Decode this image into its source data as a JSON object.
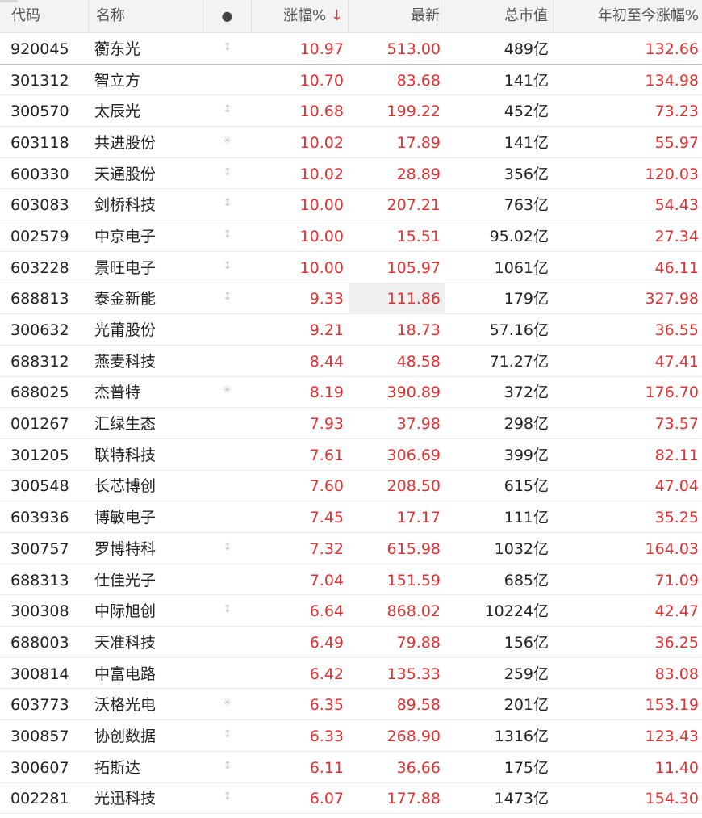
{
  "columns": {
    "code": "代码",
    "name": "名称",
    "mark": "●",
    "change_pct": "涨幅%",
    "sort_arrow": "↓",
    "last": "最新",
    "market_cap": "总市值",
    "ytd_pct": "年初至今涨幅%"
  },
  "rows": [
    {
      "code": "920045",
      "name": "蘅东光",
      "mark": "↕",
      "change_pct": "10.97",
      "last": "513.00",
      "market_cap": "489亿",
      "ytd_pct": "132.66"
    },
    {
      "code": "301312",
      "name": "智立方",
      "mark": "",
      "change_pct": "10.70",
      "last": "83.68",
      "market_cap": "141亿",
      "ytd_pct": "134.98"
    },
    {
      "code": "300570",
      "name": "太辰光",
      "mark": "↕",
      "change_pct": "10.68",
      "last": "199.22",
      "market_cap": "452亿",
      "ytd_pct": "73.23"
    },
    {
      "code": "603118",
      "name": "共进股份",
      "mark": "✳",
      "change_pct": "10.02",
      "last": "17.89",
      "market_cap": "141亿",
      "ytd_pct": "55.97"
    },
    {
      "code": "600330",
      "name": "天通股份",
      "mark": "↕",
      "change_pct": "10.02",
      "last": "28.89",
      "market_cap": "356亿",
      "ytd_pct": "120.03"
    },
    {
      "code": "603083",
      "name": "剑桥科技",
      "mark": "↕",
      "change_pct": "10.00",
      "last": "207.21",
      "market_cap": "763亿",
      "ytd_pct": "54.43"
    },
    {
      "code": "002579",
      "name": "中京电子",
      "mark": "↕",
      "change_pct": "10.00",
      "last": "15.51",
      "market_cap": "95.02亿",
      "ytd_pct": "27.34"
    },
    {
      "code": "603228",
      "name": "景旺电子",
      "mark": "↕",
      "change_pct": "10.00",
      "last": "105.97",
      "market_cap": "1061亿",
      "ytd_pct": "46.11"
    },
    {
      "code": "688813",
      "name": "泰金新能",
      "mark": "↕",
      "change_pct": "9.33",
      "last": "111.86",
      "market_cap": "179亿",
      "ytd_pct": "327.98",
      "highlight_last": true
    },
    {
      "code": "300632",
      "name": "光莆股份",
      "mark": "",
      "change_pct": "9.21",
      "last": "18.73",
      "market_cap": "57.16亿",
      "ytd_pct": "36.55"
    },
    {
      "code": "688312",
      "name": "燕麦科技",
      "mark": "",
      "change_pct": "8.44",
      "last": "48.58",
      "market_cap": "71.27亿",
      "ytd_pct": "47.41"
    },
    {
      "code": "688025",
      "name": "杰普特",
      "mark": "✳",
      "change_pct": "8.19",
      "last": "390.89",
      "market_cap": "372亿",
      "ytd_pct": "176.70"
    },
    {
      "code": "001267",
      "name": "汇绿生态",
      "mark": "",
      "change_pct": "7.93",
      "last": "37.98",
      "market_cap": "298亿",
      "ytd_pct": "73.57"
    },
    {
      "code": "301205",
      "name": "联特科技",
      "mark": "",
      "change_pct": "7.61",
      "last": "306.69",
      "market_cap": "399亿",
      "ytd_pct": "82.11"
    },
    {
      "code": "300548",
      "name": "长芯博创",
      "mark": "",
      "change_pct": "7.60",
      "last": "208.50",
      "market_cap": "615亿",
      "ytd_pct": "47.04"
    },
    {
      "code": "603936",
      "name": "博敏电子",
      "mark": "",
      "change_pct": "7.45",
      "last": "17.17",
      "market_cap": "111亿",
      "ytd_pct": "35.25"
    },
    {
      "code": "300757",
      "name": "罗博特科",
      "mark": "↕",
      "change_pct": "7.32",
      "last": "615.98",
      "market_cap": "1032亿",
      "ytd_pct": "164.03"
    },
    {
      "code": "688313",
      "name": "仕佳光子",
      "mark": "",
      "change_pct": "7.04",
      "last": "151.59",
      "market_cap": "685亿",
      "ytd_pct": "71.09"
    },
    {
      "code": "300308",
      "name": "中际旭创",
      "mark": "↕",
      "change_pct": "6.64",
      "last": "868.02",
      "market_cap": "10224亿",
      "ytd_pct": "42.47"
    },
    {
      "code": "688003",
      "name": "天准科技",
      "mark": "",
      "change_pct": "6.49",
      "last": "79.88",
      "market_cap": "156亿",
      "ytd_pct": "36.25"
    },
    {
      "code": "300814",
      "name": "中富电路",
      "mark": "",
      "change_pct": "6.42",
      "last": "135.33",
      "market_cap": "259亿",
      "ytd_pct": "83.08"
    },
    {
      "code": "603773",
      "name": "沃格光电",
      "mark": "✳",
      "change_pct": "6.35",
      "last": "89.58",
      "market_cap": "201亿",
      "ytd_pct": "153.19"
    },
    {
      "code": "300857",
      "name": "协创数据",
      "mark": "↕",
      "change_pct": "6.33",
      "last": "268.90",
      "market_cap": "1316亿",
      "ytd_pct": "123.43"
    },
    {
      "code": "300607",
      "name": "拓斯达",
      "mark": "↕",
      "change_pct": "6.11",
      "last": "36.66",
      "market_cap": "175亿",
      "ytd_pct": "11.40"
    },
    {
      "code": "002281",
      "name": "光迅科技",
      "mark": "↕",
      "change_pct": "6.07",
      "last": "177.88",
      "market_cap": "1473亿",
      "ytd_pct": "154.30"
    }
  ],
  "colors": {
    "up": "#e03232",
    "header_bg": "#f3f3f3",
    "highlight_bg": "#efefef",
    "sort_arrow": "#e0403d"
  }
}
